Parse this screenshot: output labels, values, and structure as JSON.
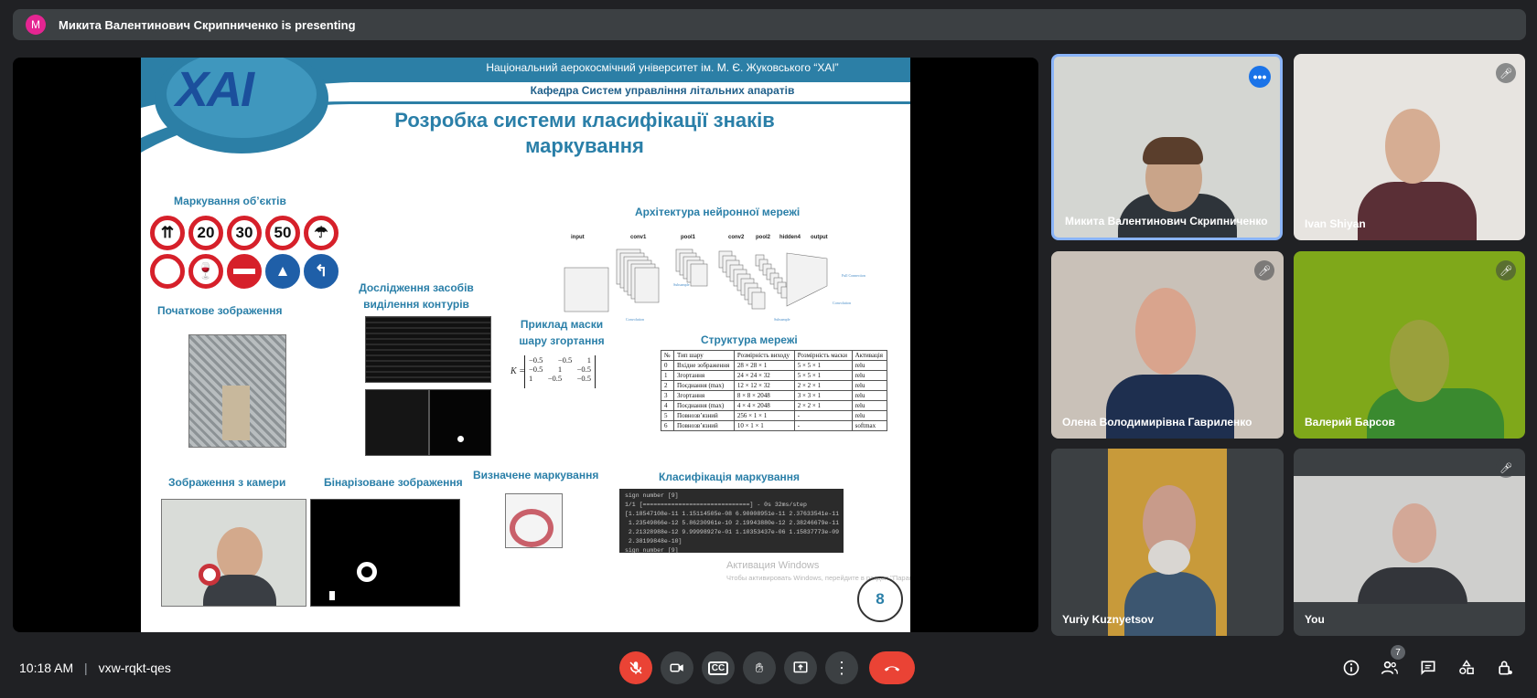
{
  "banner": {
    "avatar_letter": "M",
    "text": "Микита Валентинович Скрипниченко is presenting",
    "avatar_color": "#e52592"
  },
  "slide": {
    "university": "Національний аерокосмічний університет ім. М. Є. Жуковського “ХАІ”",
    "department": "Кафедра Систем управління літальних апаратів",
    "logo_text": "ХАІ",
    "title_line1": "Розробка системи класифікації знаків",
    "title_line2": "маркування",
    "sec_marking": "Маркування об’єктів",
    "signs": [
      "20",
      "30",
      "50"
    ],
    "sec_initial": "Початкове зображення",
    "sec_contours_1": "Дослідження засобів",
    "sec_contours_2": "виділення контурів",
    "sec_arch": "Архітектура нейронної мережі",
    "arch_labels": [
      "input",
      "conv1",
      "pool1",
      "conv2",
      "pool2",
      "hidden4",
      "output"
    ],
    "arch_notes": [
      "Subsample",
      "Convolution",
      "Subsample",
      "Full Connection",
      "Convolution"
    ],
    "sec_mask_1": "Приклад маски",
    "sec_mask_2": "шару згортання",
    "matrix_label": "K =",
    "matrix": [
      [
        "−0.5",
        "−0.5",
        "1"
      ],
      [
        "−0.5",
        "1",
        "−0.5"
      ],
      [
        "1",
        "−0.5",
        "−0.5"
      ]
    ],
    "sec_structure": "Структура мережі",
    "table_headers": [
      "№",
      "Тип шару",
      "Розмірність виходу",
      "Розмірність маски",
      "Активація"
    ],
    "table_rows": [
      [
        "0",
        "Вхідне зображення",
        "28 × 28 × 1",
        "5 × 5 × 1",
        "relu"
      ],
      [
        "1",
        "Згортання",
        "24 × 24 × 32",
        "5 × 5 × 1",
        "relu"
      ],
      [
        "2",
        "Поєднання (max)",
        "12 × 12 × 32",
        "2 × 2 × 1",
        "relu"
      ],
      [
        "3",
        "Згортання",
        "8 × 8 × 2048",
        "3 × 3 × 1",
        "relu"
      ],
      [
        "4",
        "Поєднання (max)",
        "4 × 4 × 2048",
        "2 × 2 × 1",
        "relu"
      ],
      [
        "5",
        "Повнозв’язний",
        "256 × 1 × 1",
        "-",
        "relu"
      ],
      [
        "6",
        "Повнозв’язний",
        "10 × 1 × 1",
        "-",
        "softmax"
      ]
    ],
    "sec_camera": "Зображення з камери",
    "sec_binary": "Бінарізоване зображення",
    "sec_detected": "Визначене маркування",
    "sec_classification": "Класифікація маркування",
    "console_text": "sign number [9]\n1/1 [==============================] - 0s 32ms/step\n[1.18547108e-11 1.15114505e-08 6.90008951e-11 2.37633541e-11\n 1.23549866e-12 5.86230961e-10 2.19943880e-12 2.38246679e-11\n 2.21328988e-12 9.99998927e-01 1.10353437e-06 1.15837773e-09\n 2.38199848e-10]\nsign number [9]",
    "watermark_1": "Активация Windows",
    "watermark_2": "Чтобы активировать Windows, перейдите в раздел \"Параметры\".",
    "page_number": "8"
  },
  "participants": [
    {
      "name": "Микита Валентинович Скрипниченко",
      "more": "•••"
    },
    {
      "name": "Ivan Shiyan"
    },
    {
      "name": "Олена Володимирівна Гавриленко"
    },
    {
      "name": "Валерий Барсов"
    },
    {
      "name": "Yuriy Kuznyetsov"
    },
    {
      "name": "You"
    }
  ],
  "bottom": {
    "time": "10:18 AM",
    "separator": "|",
    "meeting_code": "vxw-rqkt-qes",
    "people_count": "7",
    "cc_label": "CC"
  },
  "colors": {
    "end_call": "#ea4335",
    "mic_off": "#ea4335",
    "accent": "#1a73e8",
    "slide_heading": "#2a7fa8"
  }
}
